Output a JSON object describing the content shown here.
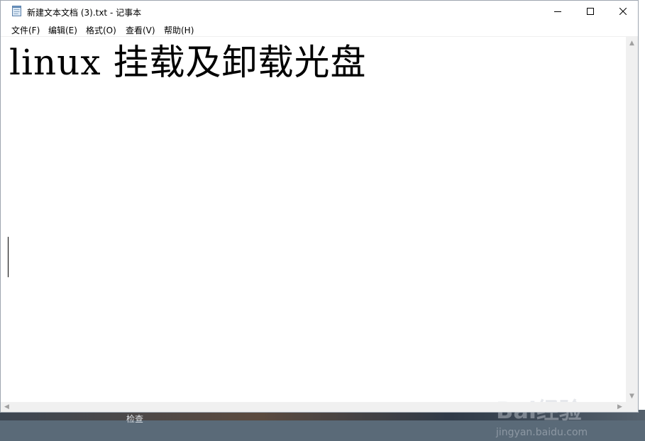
{
  "window": {
    "title": "新建文本文档 (3).txt - 记事本"
  },
  "menu": {
    "items": [
      {
        "label": "文件(F)"
      },
      {
        "label": "编辑(E)"
      },
      {
        "label": "格式(O)"
      },
      {
        "label": "查看(V)"
      },
      {
        "label": "帮助(H)"
      }
    ]
  },
  "editor": {
    "content": "linux 挂载及卸载光盘"
  },
  "watermark": {
    "brand": "Bai经验",
    "url": "jingyan.baidu.com"
  },
  "background": {
    "taskbar_text": "检查"
  },
  "icons": {
    "app": "notepad-icon",
    "minimize": "minimize-icon",
    "maximize": "maximize-icon",
    "close": "close-icon"
  }
}
